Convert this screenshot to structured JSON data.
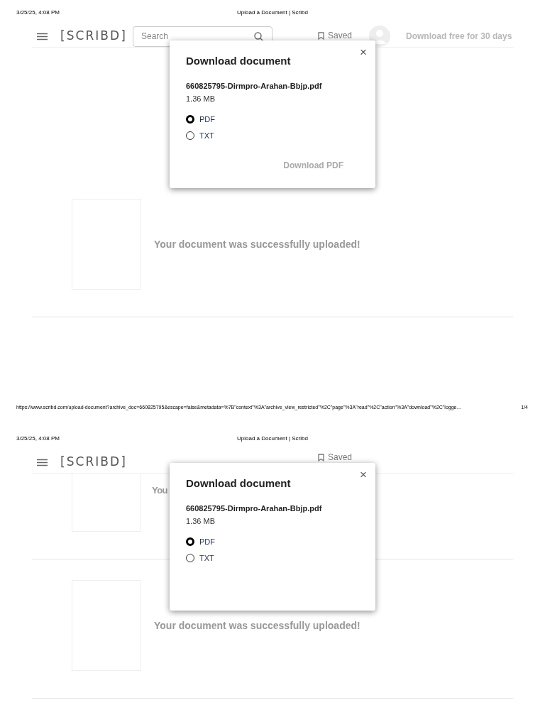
{
  "pages": [
    {
      "print_header": {
        "date": "3/25/25, 4:08 PM",
        "title": "Upload a Document | Scribd"
      },
      "nav": {
        "logo": "[SCRIBD]",
        "search": {
          "placeholder": "Search"
        },
        "saved": "Saved",
        "avatar": true,
        "cta": "Download free for 30 days"
      },
      "uploads": [
        {
          "kind": "full",
          "message": "Your document was successfully uploaded!"
        }
      ],
      "dialog": {
        "title": "Download document",
        "close": "×",
        "filename": "660825795-Dirmpro-Arahan-Bbjp.pdf",
        "size": "1.36 MB",
        "formats": [
          {
            "label": "PDF",
            "selected": true
          },
          {
            "label": "TXT",
            "selected": false
          }
        ],
        "button": "Download PDF"
      },
      "print_footer": {
        "url": "https://www.scribd.com/upload-document?archive_doc=660825795&escape=false&metadata=%7B\"context\"%3A\"archive_view_restricted\"%2C\"page\"%3A\"read\"%2C\"action\"%3A\"download\"%2C\"logge…",
        "page": "1/4"
      }
    },
    {
      "print_header": {
        "date": "3/25/25, 4:08 PM",
        "title": "Upload a Document | Scribd"
      },
      "nav": {
        "logo": "[SCRIBD]",
        "saved": "Saved"
      },
      "uploads": [
        {
          "kind": "clipped",
          "message": "You"
        },
        {
          "kind": "full",
          "message": "Your document was successfully uploaded!"
        }
      ],
      "dialog": {
        "title": "Download document",
        "close": "×",
        "filename": "660825795-Dirmpro-Arahan-Bbjp.pdf",
        "size": "1.36 MB",
        "formats": [
          {
            "label": "PDF",
            "selected": true
          },
          {
            "label": "TXT",
            "selected": false
          }
        ]
      }
    }
  ]
}
